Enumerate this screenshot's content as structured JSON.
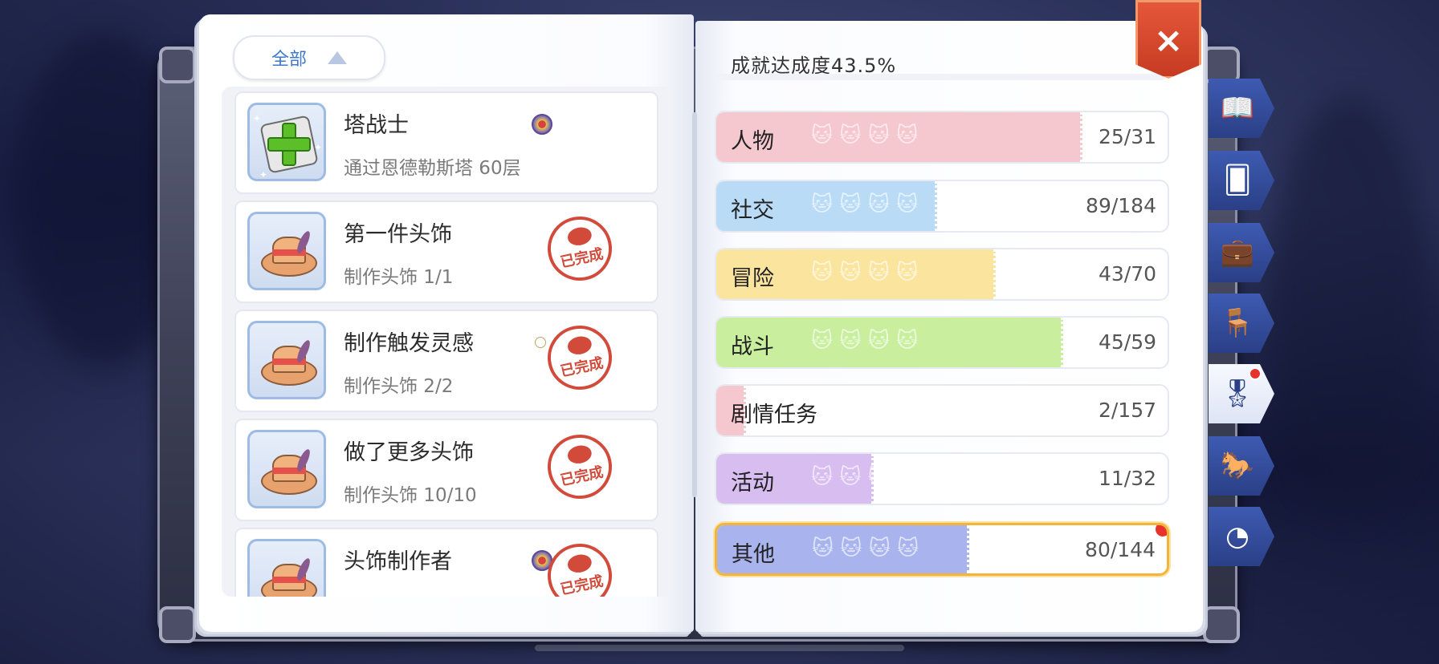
{
  "filter": {
    "label": "全部"
  },
  "achievements": [
    {
      "title": "塔战士",
      "desc": "通过恩德勒斯塔 60层",
      "icon": "scroll-plus-icon",
      "completed": false,
      "medal": true
    },
    {
      "title": "第一件头饰",
      "desc": "制作头饰 1/1",
      "icon": "hat-icon",
      "completed": true,
      "medal": false
    },
    {
      "title": "制作触发灵感",
      "desc": "制作头饰 2/2",
      "icon": "hat-icon",
      "completed": true,
      "medal": false
    },
    {
      "title": "做了更多头饰",
      "desc": "制作头饰 10/10",
      "icon": "hat-icon",
      "completed": true,
      "medal": false
    },
    {
      "title": "头饰制作者",
      "desc": "",
      "icon": "hat-icon",
      "completed": true,
      "medal": true
    }
  ],
  "stamp_text": "已完成",
  "completion_text": "成就达成度43.5%",
  "categories": [
    {
      "label": "人物",
      "count": "25/31",
      "progress": 0.806,
      "color": "#f5c7cf"
    },
    {
      "label": "社交",
      "count": "89/184",
      "progress": 0.484,
      "color": "#b9dbf6"
    },
    {
      "label": "冒险",
      "count": "43/70",
      "progress": 0.614,
      "color": "#fbe59e"
    },
    {
      "label": "战斗",
      "count": "45/59",
      "progress": 0.763,
      "color": "#c9ef9e"
    },
    {
      "label": "剧情任务",
      "count": "2/157",
      "progress": 0.013,
      "color": "#f5c7cf"
    },
    {
      "label": "活动",
      "count": "11/32",
      "progress": 0.344,
      "color": "#d8bdf1"
    },
    {
      "label": "其他",
      "count": "80/144",
      "progress": 0.556,
      "color": "#a9b4ee"
    }
  ],
  "close_label": "×",
  "side_tabs": [
    {
      "icon": "book-icon",
      "glyph": "📖"
    },
    {
      "icon": "card-icon",
      "glyph": "🂠"
    },
    {
      "icon": "briefcase-heart-icon",
      "glyph": "💼"
    },
    {
      "icon": "armchair-icon",
      "glyph": "🪑"
    },
    {
      "icon": "medal-icon",
      "glyph": "🎖",
      "active": true
    },
    {
      "icon": "rocking-horse-icon",
      "glyph": "🐎"
    },
    {
      "icon": "gauge-icon",
      "glyph": "◔"
    }
  ]
}
